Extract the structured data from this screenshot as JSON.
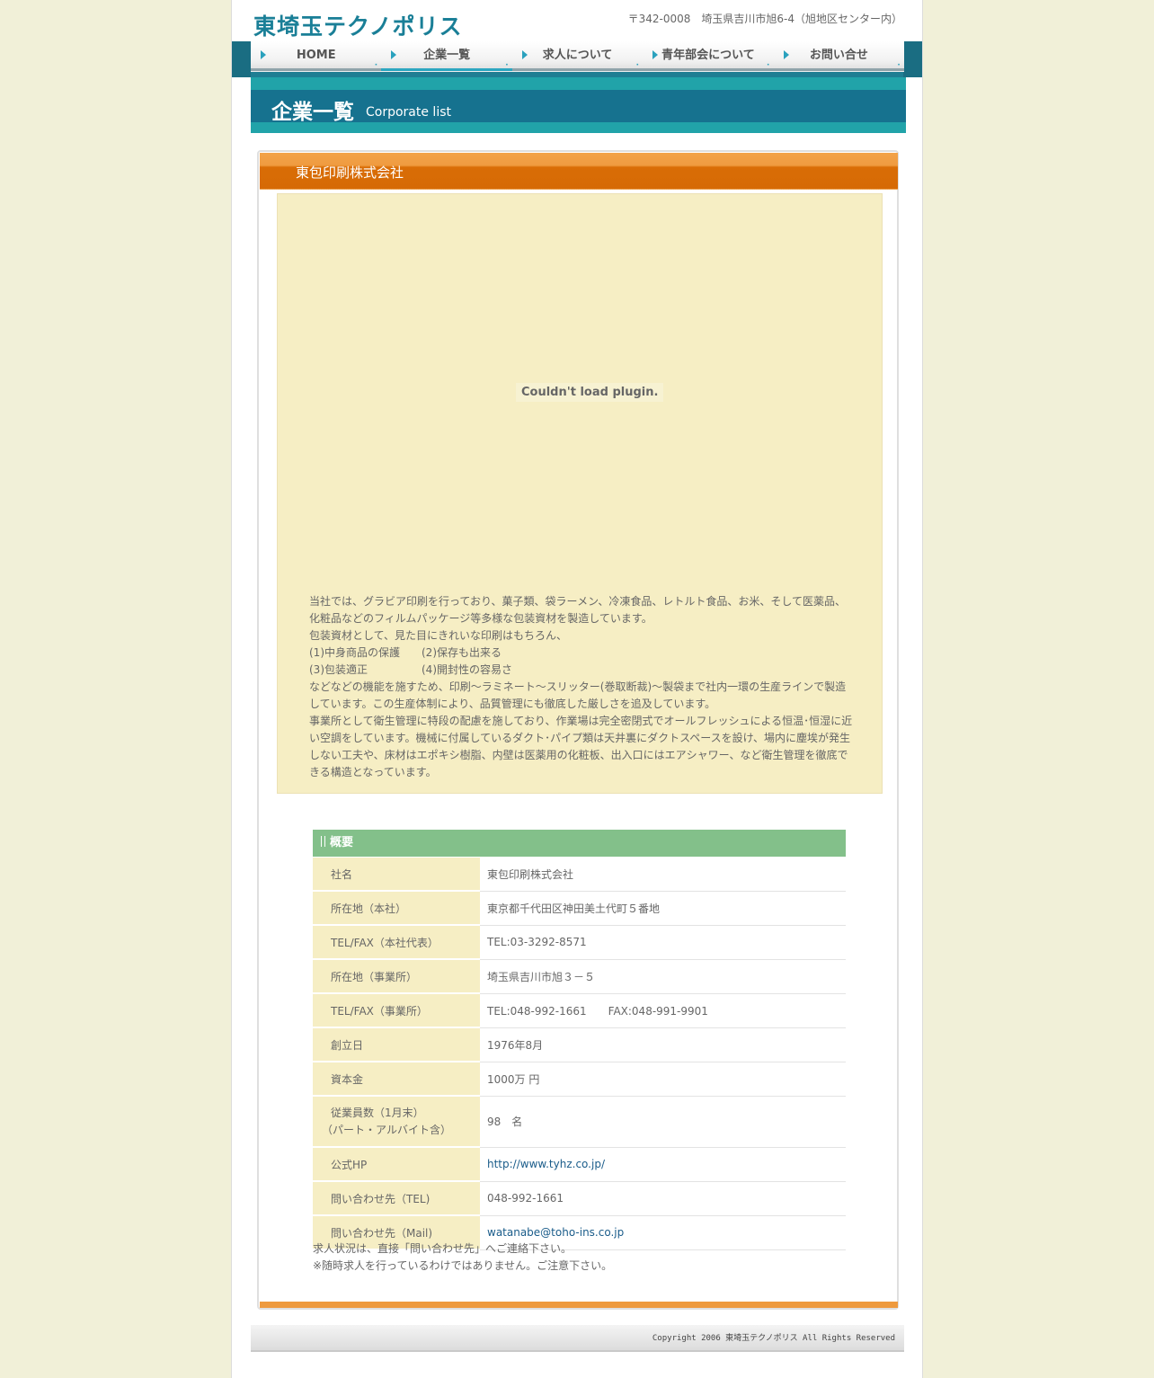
{
  "header": {
    "logo": "東埼玉テクノポリス",
    "address": "〒342-0008　埼玉県吉川市旭6-4（旭地区センター内）"
  },
  "nav": {
    "items": [
      {
        "label": "HOME"
      },
      {
        "label": "企業一覧"
      },
      {
        "label": "求人について"
      },
      {
        "label": "青年部会について"
      },
      {
        "label": "お問い合せ"
      }
    ]
  },
  "title": {
    "ja": "企業一覧",
    "en": "Corporate list"
  },
  "company": {
    "name": "東包印刷株式会社",
    "plugin_message": "Couldn't load plugin.",
    "intro_lines": [
      "当社では、グラビア印刷を行っており、菓子類、袋ラーメン、冷凍食品、レトルト食品、お米、そして医薬品、化粧品などのフィルムパッケージ等多様な包装資材を製造しています。",
      "包装資材として、見た目にきれいな印刷はもちろん、",
      "(1)中身商品の保護　　(2)保存も出来る",
      "(3)包装適正　　　　　(4)開封性の容易さ",
      "などなどの機能を施すため、印刷～ラミネート～スリッター(巻取断裁)～製袋まで社内一環の生産ラインで製造しています。この生産体制により、品質管理にも徹底した厳しさを追及しています。",
      "事業所として衛生管理に特段の配慮を施しており、作業場は完全密閉式でオールフレッシュによる恒温･恒湿に近い空調をしています。機械に付属しているダクト･パイプ類は天井裏にダクトスペースを設け、場内に塵埃が発生しない工夫や、床材はエポキシ樹脂、内壁は医薬用の化粧板、出入口にはエアシャワー、など衛生管理を徹底できる構造となっています。"
    ]
  },
  "overview": {
    "heading": "概要",
    "rows": [
      {
        "key": "社名",
        "value": "東包印刷株式会社"
      },
      {
        "key": "所在地（本社）",
        "value": "東京都千代田区神田美土代町５番地"
      },
      {
        "key": "TEL/FAX（本社代表）",
        "value": "TEL:03-3292-8571"
      },
      {
        "key": "所在地（事業所）",
        "value": "埼玉県吉川市旭３－５"
      },
      {
        "key": "TEL/FAX（事業所）",
        "value": "TEL:048-992-1661　　FAX:048-991-9901"
      },
      {
        "key": "創立日",
        "value": "1976年8月"
      },
      {
        "key": "資本金",
        "value": "1000万 円"
      },
      {
        "key": "従業員数（1月末）",
        "key2": "（パート・アルバイト含）",
        "value": "98　名"
      },
      {
        "key": "公式HP",
        "value": "http://www.tyhz.co.jp/"
      },
      {
        "key": "問い合わせ先（TEL)",
        "value": "048-992-1661"
      },
      {
        "key": "問い合わせ先（Mail)",
        "value": "watanabe@toho-ins.co.jp"
      }
    ],
    "notes": [
      "求人状況は、直接「問い合わせ先」へご連絡下さい。",
      "※随時求人を行っているわけではありません。ご注意下さい。"
    ]
  },
  "footer": {
    "copyright": "Copyright 2006 東埼玉テクノポリス All Rights Reserved"
  },
  "colors": {
    "accent_teal": "#1a7f97",
    "panel_orange": "#d96d06",
    "overview_green": "#83c08a",
    "cream": "#f6eec4"
  }
}
